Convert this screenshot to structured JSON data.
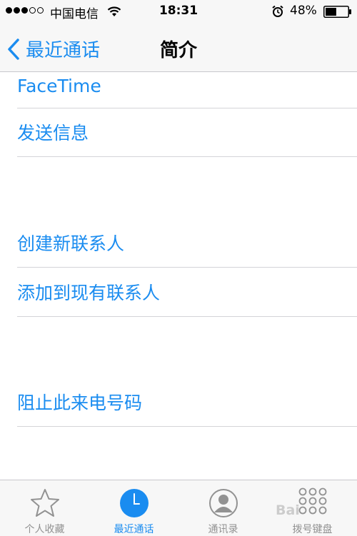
{
  "status_bar": {
    "carrier": "中国电信",
    "time": "18:31",
    "battery_percent": "48%",
    "battery_level": 0.48
  },
  "nav": {
    "back_label": "最近通话",
    "title": "简介"
  },
  "actions": [
    {
      "label": "FaceTime"
    },
    {
      "label": "发送信息"
    },
    {
      "label": "创建新联系人"
    },
    {
      "label": "添加到现有联系人"
    },
    {
      "label": "阻止此来电号码"
    }
  ],
  "tabs": [
    {
      "label": "个人收藏",
      "icon": "star-icon",
      "active": false
    },
    {
      "label": "最近通话",
      "icon": "clock-icon",
      "active": true
    },
    {
      "label": "通讯录",
      "icon": "contacts-icon",
      "active": false
    },
    {
      "label": "拨号键盘",
      "icon": "keypad-icon",
      "active": false
    }
  ],
  "watermark": "Bai",
  "colors": {
    "accent": "#1a8cf0",
    "inactive": "#929292",
    "bar_background": "#f7f7f7"
  }
}
